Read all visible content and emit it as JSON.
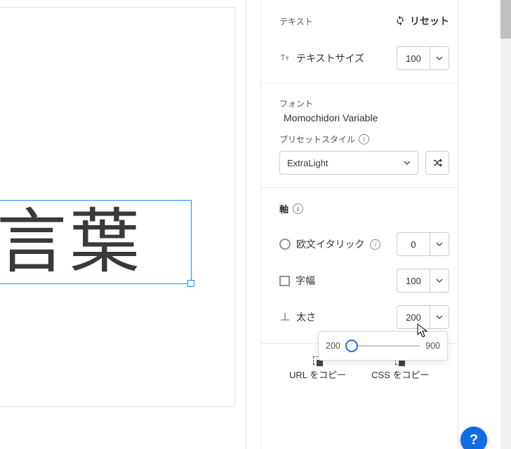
{
  "preview": {
    "text": "る言葉"
  },
  "text_section": {
    "title": "テキスト",
    "reset_label": "リセット",
    "size_label": "テキストサイズ",
    "size_value": "100"
  },
  "font_section": {
    "title": "フォント",
    "name": "Momochidori Variable",
    "preset_label": "プリセットスタイル",
    "preset_value": "ExtraLight"
  },
  "axes": {
    "title": "軸",
    "italic": {
      "label": "欧文イタリック",
      "value": "0"
    },
    "width": {
      "label": "字幅",
      "value": "100"
    },
    "weight": {
      "label": "太さ",
      "value": "200",
      "min": "200",
      "max": "900"
    }
  },
  "copy": {
    "url_label": "URL をコピー",
    "css_label": "CSS をコピー"
  },
  "help": {
    "label": "?"
  }
}
